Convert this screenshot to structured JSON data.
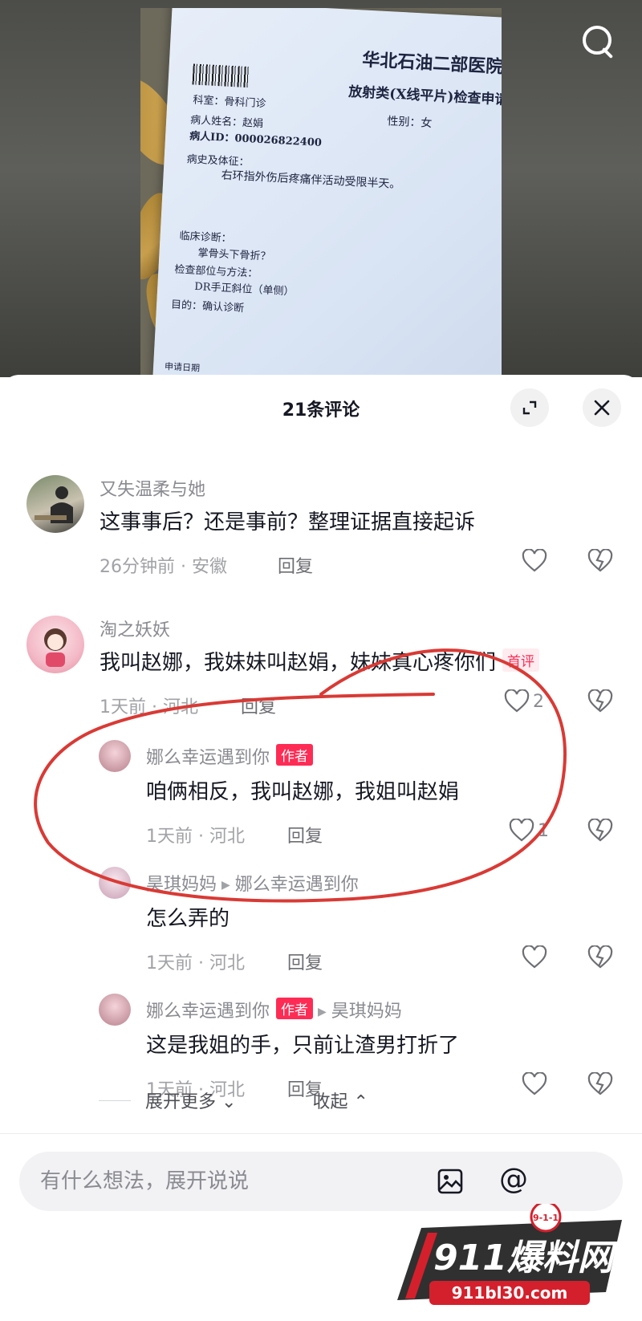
{
  "photo": {
    "doc_title": "华北石油二部医院",
    "doc_subtitle": "放射类(X线平片)检查申请单",
    "dept": "科室：骨科门诊",
    "gender": "性别：女",
    "patient_name": "病人姓名：赵娟",
    "patient_id": "病人ID：000026822400",
    "history_label": "病史及体征：",
    "history": "右环指外伤后疼痛伴活动受限半天。",
    "diag_label": "临床诊断：",
    "diag": "掌骨头下骨折？",
    "method_label": "检查部位与方法：",
    "method": "DR手正斜位（单侧）",
    "purpose": "目的：确认诊断",
    "date_partial": "申请日期"
  },
  "sheet": {
    "title": "21条评论"
  },
  "comments": [
    {
      "user": "又失温柔与她",
      "text": "这事事后？还是事前？整理证据直接起诉",
      "meta": "26分钟前 · 安徽",
      "reply": "回复",
      "likes": ""
    },
    {
      "user": "淘之妖妖",
      "text": "我叫赵娜，我妹妹叫赵娟，妹妹真心疼你们",
      "badge": "首评",
      "meta": "1天前 · 河北",
      "reply": "回复",
      "likes": "2"
    },
    {
      "user": "娜么幸运遇到你",
      "badge": "作者",
      "text": "咱俩相反，我叫赵娜，我姐叫赵娟",
      "meta": "1天前 · 河北",
      "reply": "回复",
      "likes": "1"
    },
    {
      "user": "昊琪妈妈",
      "reply_to": "娜么幸运遇到你",
      "text": "怎么弄的",
      "meta": "1天前 · 河北",
      "reply": "回复",
      "likes": ""
    },
    {
      "user": "娜么幸运遇到你",
      "badge": "作者",
      "reply_to": "昊琪妈妈",
      "text": "这是我姐的手，只前让渣男打折了",
      "meta": "1天前 · 河北",
      "reply": "回复",
      "likes": ""
    }
  ],
  "expand": {
    "more": "展开更多",
    "collapse": "收起"
  },
  "input": {
    "placeholder": "有什么想法，展开说说"
  },
  "watermark": {
    "brand": "911爆料网",
    "url": "911bl30.com",
    "badge": "9-1-1"
  }
}
